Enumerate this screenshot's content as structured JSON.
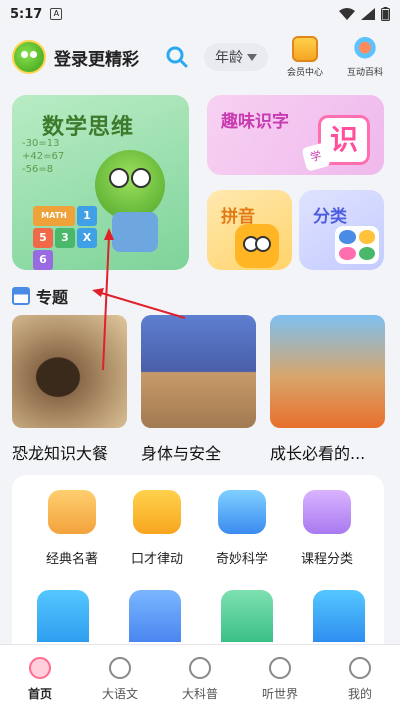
{
  "status_bar": {
    "time": "5:17",
    "notification_glyph": "A"
  },
  "header": {
    "login_text": "登录更精彩",
    "age_label": "年龄",
    "buttons": [
      {
        "label": "会员中心",
        "icon": "vip-crown-icon"
      },
      {
        "label": "互动百科",
        "icon": "globe-icon"
      }
    ]
  },
  "feature_cards": {
    "math": {
      "title": "数学思维",
      "board": [
        "-30=13",
        "+42=67",
        "-56=8"
      ],
      "blocks_top": "MATH",
      "blocks": [
        "1",
        "5",
        "3",
        "X",
        "6"
      ]
    },
    "word": {
      "title": "趣味识字",
      "tile_char": "识",
      "small_char": "学"
    },
    "pinyin": {
      "title": "拼音"
    },
    "classify": {
      "title": "分类"
    }
  },
  "topics_section": {
    "title": "专题",
    "items": [
      {
        "label": "恐龙知识大餐"
      },
      {
        "label": "身体与安全"
      },
      {
        "label": "成长必看的..."
      }
    ]
  },
  "category_grid": {
    "items": [
      {
        "label": "经典名著",
        "icon": "book-icon"
      },
      {
        "label": "口才律动",
        "icon": "speech-icon"
      },
      {
        "label": "奇妙科学",
        "icon": "flask-icon"
      },
      {
        "label": "课程分类",
        "icon": "easel-icon"
      }
    ]
  },
  "tabbar": {
    "tabs": [
      {
        "label": "首页",
        "icon": "home-icon",
        "active": true
      },
      {
        "label": "大语文",
        "icon": "chinese-icon",
        "active": false
      },
      {
        "label": "大科普",
        "icon": "science-icon",
        "active": false
      },
      {
        "label": "听世界",
        "icon": "headphone-icon",
        "active": false
      },
      {
        "label": "我的",
        "icon": "profile-icon",
        "active": false
      }
    ]
  },
  "colors": {
    "accent": "#ff6b8f",
    "annotation_arrow": "#e0202a"
  }
}
